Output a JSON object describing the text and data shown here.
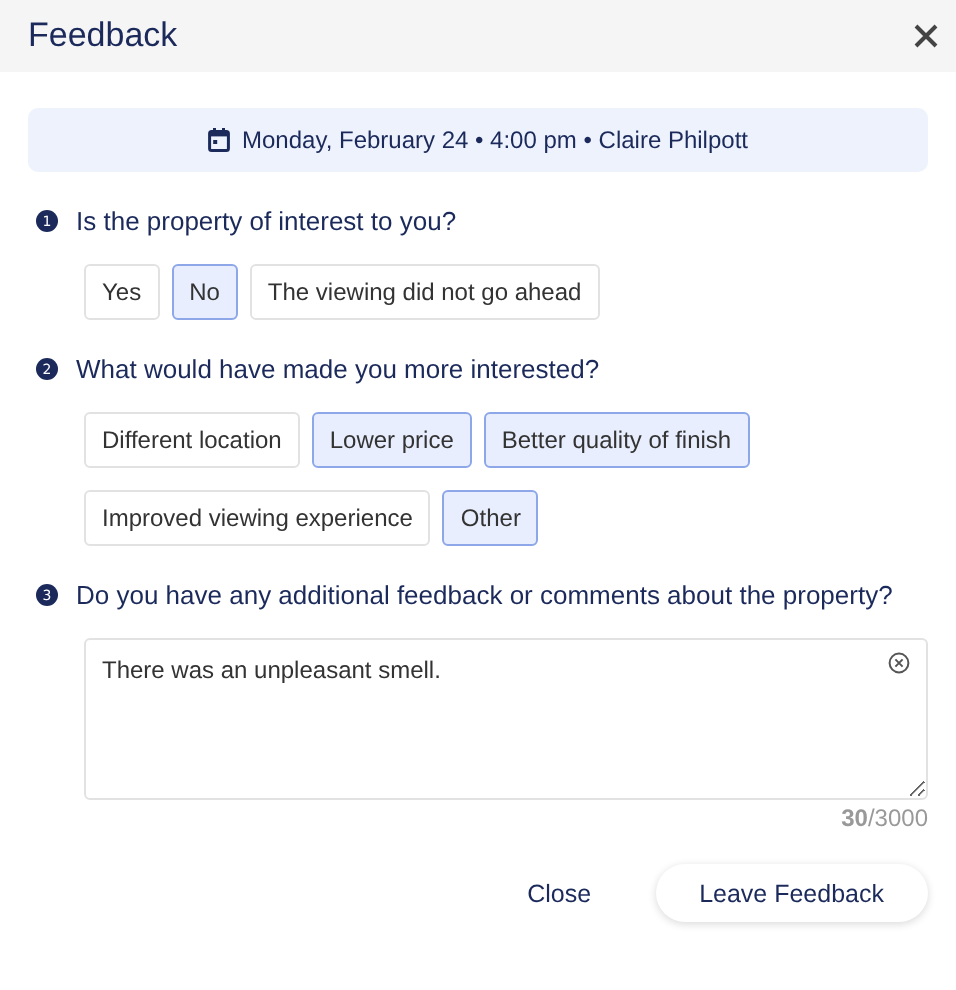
{
  "window": {
    "title": "Feedback"
  },
  "appointment": "Monday, February 24 • 4:00 pm • Claire Philpott",
  "questions": [
    {
      "number": "1",
      "text": "Is the property of interest to you?",
      "kind": "choices",
      "options": [
        {
          "label": "Yes",
          "selected": false
        },
        {
          "label": "No",
          "selected": true
        },
        {
          "label": "The viewing did not go ahead",
          "selected": false
        }
      ]
    },
    {
      "number": "2",
      "text": "What would have made you more interested?",
      "kind": "choices",
      "options": [
        {
          "label": "Different location",
          "selected": false
        },
        {
          "label": "Lower price",
          "selected": true
        },
        {
          "label": "Better quality of finish",
          "selected": true
        },
        {
          "label": "Improved viewing experience",
          "selected": false
        },
        {
          "label": "Other",
          "selected": true
        }
      ]
    },
    {
      "number": "3",
      "text": "Do you have any additional feedback or comments about the property?",
      "kind": "text",
      "value": "There was an unpleasant smell.",
      "counter": "**30**/3000"
    }
  ],
  "buttons": [
    "Close",
    "Leave Feedback"
  ]
}
